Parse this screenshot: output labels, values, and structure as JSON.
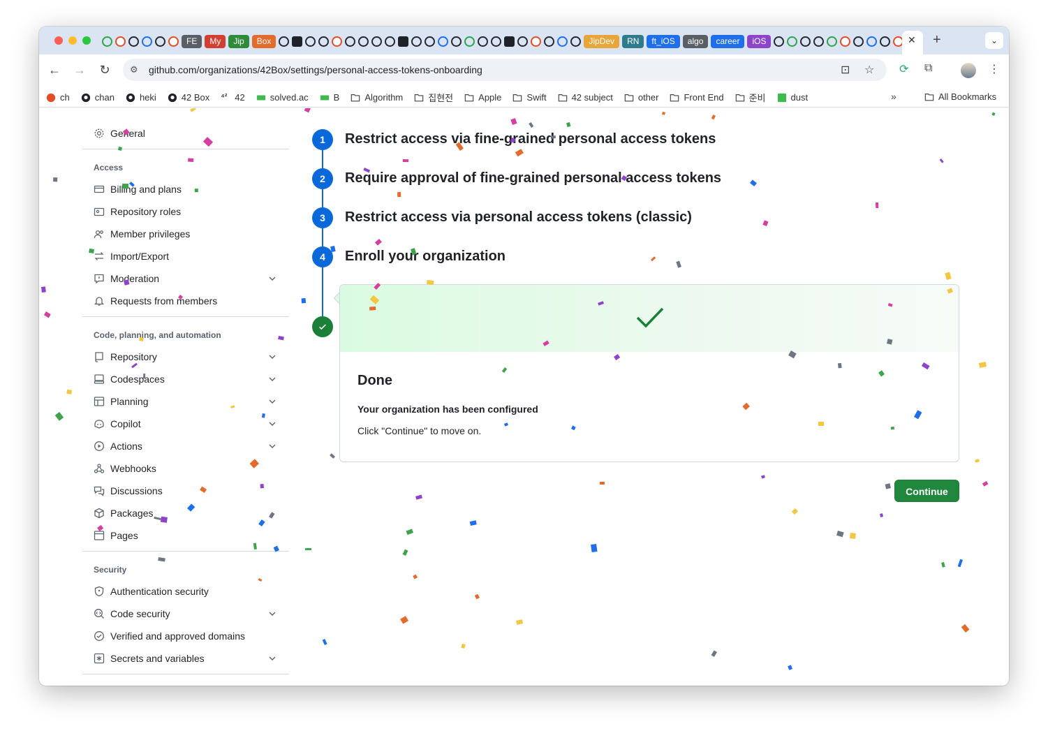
{
  "browser": {
    "tab_chips": [
      {
        "label": "FE",
        "color": "#5a5f66"
      },
      {
        "label": "My",
        "color": "#d23f31"
      },
      {
        "label": "Jip",
        "color": "#2e8b3a"
      },
      {
        "label": "Box",
        "color": "#e36b2c"
      },
      {
        "label": "JipDev",
        "color": "#e8a53a"
      },
      {
        "label": "RN",
        "color": "#2f7b8c"
      },
      {
        "label": "ft_iOS",
        "color": "#1f6feb"
      },
      {
        "label": "algo",
        "color": "#5a5f66"
      },
      {
        "label": "career",
        "color": "#1f6feb"
      },
      {
        "label": "iOS",
        "color": "#8e44c9"
      }
    ],
    "url": "github.com/organizations/42Box/settings/personal-access-tokens-onboarding"
  },
  "bookmarks": [
    {
      "label": "ch",
      "icon": "red-circle-icon"
    },
    {
      "label": "chan",
      "icon": "github-icon"
    },
    {
      "label": "heki",
      "icon": "github-icon"
    },
    {
      "label": "42 Box",
      "icon": "github-icon"
    },
    {
      "label": "42",
      "icon": "42-icon"
    },
    {
      "label": "solved.ac",
      "icon": "solved-icon"
    },
    {
      "label": "B",
      "icon": "solved-icon"
    },
    {
      "label": "Algorithm",
      "icon": "folder-icon"
    },
    {
      "label": "집현전",
      "icon": "folder-icon"
    },
    {
      "label": "Apple",
      "icon": "folder-icon"
    },
    {
      "label": "Swift",
      "icon": "folder-icon"
    },
    {
      "label": "42 subject",
      "icon": "folder-icon"
    },
    {
      "label": "other",
      "icon": "folder-icon"
    },
    {
      "label": "Front End",
      "icon": "folder-icon"
    },
    {
      "label": "준비",
      "icon": "folder-icon"
    },
    {
      "label": "dust",
      "icon": "notion-icon"
    }
  ],
  "bookmarks_all": "All Bookmarks",
  "sidebar": {
    "general": "General",
    "access_head": "Access",
    "access": [
      "Billing and plans",
      "Repository roles",
      "Member privileges",
      "Import/Export",
      "Moderation",
      "Requests from members"
    ],
    "code_head": "Code, planning, and automation",
    "code": [
      "Repository",
      "Codespaces",
      "Planning",
      "Copilot",
      "Actions",
      "Webhooks",
      "Discussions",
      "Packages",
      "Pages"
    ],
    "security_head": "Security",
    "security": [
      "Authentication security",
      "Code security",
      "Verified and approved domains",
      "Secrets and variables"
    ]
  },
  "steps": [
    {
      "num": "1",
      "title": "Restrict access via fine-grained personal access tokens"
    },
    {
      "num": "2",
      "title": "Require approval of fine-grained personal access tokens"
    },
    {
      "num": "3",
      "title": "Restrict access via personal access tokens (classic)"
    },
    {
      "num": "4",
      "title": "Enroll your organization"
    }
  ],
  "done_card": {
    "title": "Done",
    "subtitle": "Your organization has been configured",
    "text": "Click \"Continue\" to move on."
  },
  "continue_label": "Continue",
  "colors": {
    "accent_blue": "#0969da",
    "success_green": "#1a7f37",
    "button_green": "#1f883d"
  }
}
